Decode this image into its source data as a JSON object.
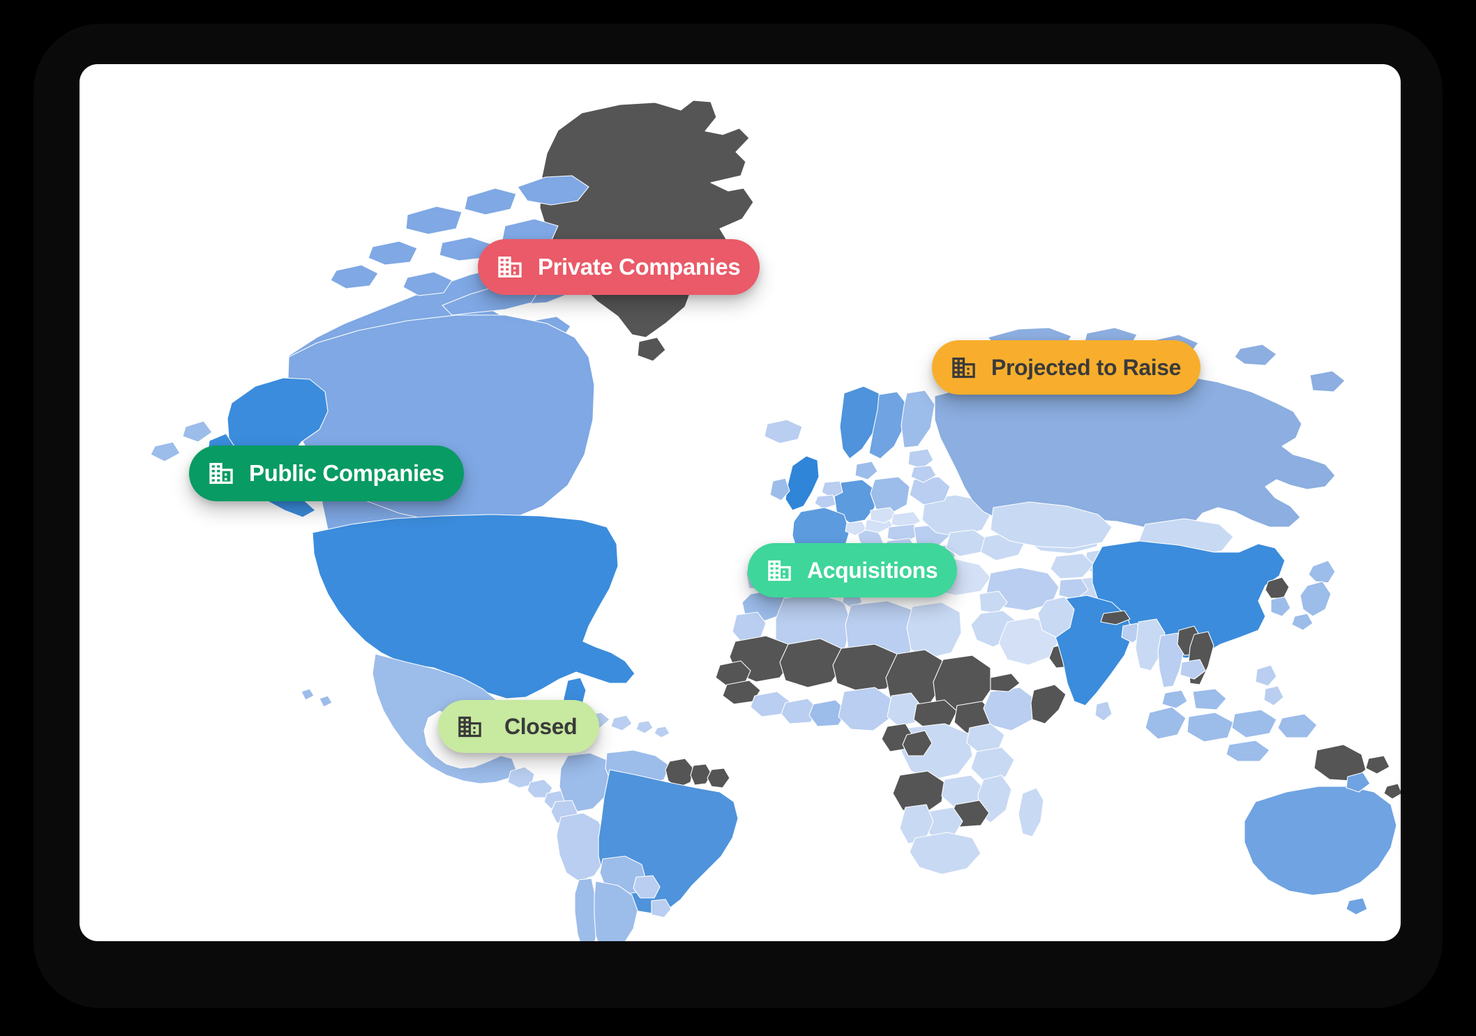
{
  "card": {
    "background": "#ffffff",
    "frame_background": "#000000"
  },
  "map": {
    "name": "world-choropleth-map",
    "ocean_color": "#ffffff",
    "border_color": "#ffffff",
    "palette": {
      "blue_darkest": "#2F85D8",
      "blue_dark": "#3B8CDC",
      "blue_mid": "#6FA3E2",
      "blue_light": "#9CBCEA",
      "blue_lighter": "#B9CEF0",
      "blue_lightest": "#D3E0F6",
      "gray_dark": "#555555"
    }
  },
  "legend": {
    "items": [
      {
        "id": "private-companies",
        "label": "Private Companies",
        "icon": "office-building-icon",
        "background": "#EA5A68",
        "text_color": "#ffffff"
      },
      {
        "id": "projected-to-raise",
        "label": "Projected to Raise",
        "icon": "office-building-icon",
        "background": "#F8AE2C",
        "text_color": "#3a3a3a"
      },
      {
        "id": "public-companies",
        "label": "Public Companies",
        "icon": "office-building-icon",
        "background": "#089B63",
        "text_color": "#ffffff"
      },
      {
        "id": "acquisitions",
        "label": "Acquisitions",
        "icon": "office-building-icon",
        "background": "#3ED69A",
        "text_color": "#ffffff"
      },
      {
        "id": "closed",
        "label": "Closed",
        "icon": "office-building-icon",
        "background": "#C7E9A0",
        "text_color": "#3a3a3a"
      }
    ]
  }
}
